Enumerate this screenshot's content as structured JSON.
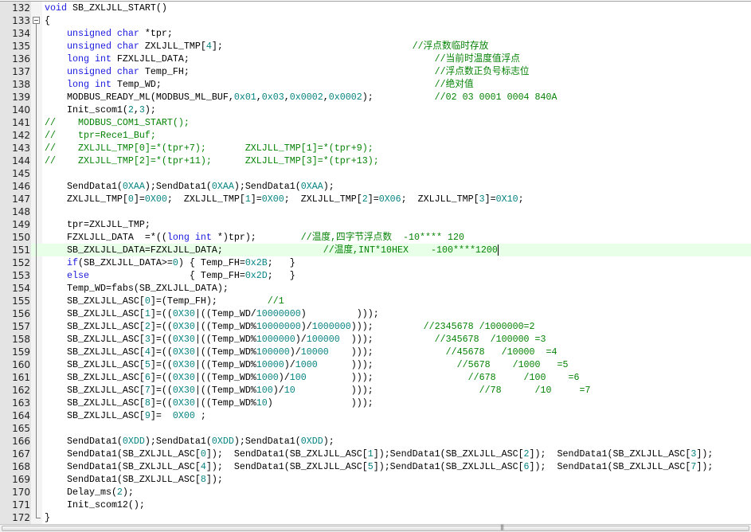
{
  "editor": {
    "first_line_number": 132,
    "current_line_number": 151,
    "folded_line_number": 133,
    "colors": {
      "keyword": "#1a1adf",
      "number": "#008080",
      "comment": "#008000",
      "current_line": "#e8ffe8",
      "gutter": "#e4e4e4"
    },
    "keywords": [
      "void",
      "unsigned",
      "char",
      "long",
      "int",
      "if",
      "else"
    ],
    "lines": [
      {
        "n": "132",
        "text": "void SB_ZXLJLL_START()"
      },
      {
        "n": "133",
        "text": "{"
      },
      {
        "n": "134",
        "text": "    unsigned char *tpr;"
      },
      {
        "n": "135",
        "text": "    unsigned char ZXLJLL_TMP[4];                                  //浮点数临时存放"
      },
      {
        "n": "136",
        "text": "    long int FZXLJLL_DATA;                                            //当前时温度值浮点"
      },
      {
        "n": "137",
        "text": "    unsigned char Temp_FH;                                            //浮点数正负号标志位"
      },
      {
        "n": "138",
        "text": "    long int Temp_WD;                                                 //绝对值"
      },
      {
        "n": "139",
        "text": "    MODBUS_READY_ML(MODBUS_ML_BUF,0x01,0x03,0x0002,0x0002);           //02 03 0001 0004 840A"
      },
      {
        "n": "140",
        "text": "    Init_scom1(2,3);"
      },
      {
        "n": "141",
        "text": "//    MODBUS_COM1_START();"
      },
      {
        "n": "142",
        "text": "//    tpr=Rece1_Buf;"
      },
      {
        "n": "143",
        "text": "//    ZXLJLL_TMP[0]=*(tpr+7);       ZXLJLL_TMP[1]=*(tpr+9);"
      },
      {
        "n": "144",
        "text": "//    ZXLJLL_TMP[2]=*(tpr+11);      ZXLJLL_TMP[3]=*(tpr+13);"
      },
      {
        "n": "145",
        "text": ""
      },
      {
        "n": "146",
        "text": "    SendData1(0XAA);SendData1(0XAA);SendData1(0XAA);"
      },
      {
        "n": "147",
        "text": "    ZXLJLL_TMP[0]=0X00;  ZXLJLL_TMP[1]=0X00;  ZXLJLL_TMP[2]=0X06;  ZXLJLL_TMP[3]=0X10;"
      },
      {
        "n": "148",
        "text": ""
      },
      {
        "n": "149",
        "text": "    tpr=ZXLJLL_TMP;"
      },
      {
        "n": "150",
        "text": "    FZXLJLL_DATA  =*((long int *)tpr);        //温度,四字节浮点数  -10**** 120"
      },
      {
        "n": "151",
        "text": "    SB_ZXLJLL_DATA=FZXLJLL_DATA;                  //温度,INT*10HEX    -100****1200"
      },
      {
        "n": "152",
        "text": "    if(SB_ZXLJLL_DATA>=0) { Temp_FH=0x2B;   }"
      },
      {
        "n": "153",
        "text": "    else                  { Temp_FH=0x2D;   }"
      },
      {
        "n": "154",
        "text": "    Temp_WD=fabs(SB_ZXLJLL_DATA);"
      },
      {
        "n": "155",
        "text": "    SB_ZXLJLL_ASC[0]=(Temp_FH);         //1"
      },
      {
        "n": "156",
        "text": "    SB_ZXLJLL_ASC[1]=((0X30|((Temp_WD/10000000)         )));"
      },
      {
        "n": "157",
        "text": "    SB_ZXLJLL_ASC[2]=((0X30|((Temp_WD%10000000)/1000000)));         //2345678 /1000000=2"
      },
      {
        "n": "158",
        "text": "    SB_ZXLJLL_ASC[3]=((0X30|((Temp_WD%1000000)/100000  )));           //345678  /100000 =3"
      },
      {
        "n": "159",
        "text": "    SB_ZXLJLL_ASC[4]=((0X30|((Temp_WD%100000)/10000    )));             //45678   /10000  =4"
      },
      {
        "n": "160",
        "text": "    SB_ZXLJLL_ASC[5]=((0X30|((Temp_WD%10000)/1000      )));               //5678    /1000   =5"
      },
      {
        "n": "161",
        "text": "    SB_ZXLJLL_ASC[6]=((0X30|((Temp_WD%1000)/100        )));                 //678     /100    =6"
      },
      {
        "n": "162",
        "text": "    SB_ZXLJLL_ASC[7]=((0X30|((Temp_WD%100)/10          )));                   //78      /10     =7"
      },
      {
        "n": "163",
        "text": "    SB_ZXLJLL_ASC[8]=((0X30|((Temp_WD%10)              )));"
      },
      {
        "n": "164",
        "text": "    SB_ZXLJLL_ASC[9]=  0X00 ;"
      },
      {
        "n": "165",
        "text": ""
      },
      {
        "n": "166",
        "text": "    SendData1(0XDD);SendData1(0XDD);SendData1(0XDD);"
      },
      {
        "n": "167",
        "text": "    SendData1(SB_ZXLJLL_ASC[0]);  SendData1(SB_ZXLJLL_ASC[1]);SendData1(SB_ZXLJLL_ASC[2]);  SendData1(SB_ZXLJLL_ASC[3]);"
      },
      {
        "n": "168",
        "text": "    SendData1(SB_ZXLJLL_ASC[4]);  SendData1(SB_ZXLJLL_ASC[5]);SendData1(SB_ZXLJLL_ASC[6]);  SendData1(SB_ZXLJLL_ASC[7]);"
      },
      {
        "n": "169",
        "text": "    SendData1(SB_ZXLJLL_ASC[8]);"
      },
      {
        "n": "170",
        "text": "    Delay_ms(2);"
      },
      {
        "n": "171",
        "text": "    Init_scom12();"
      },
      {
        "n": "172",
        "text": "}"
      }
    ]
  },
  "scrollbar": {
    "grip_glyph": "|||"
  }
}
